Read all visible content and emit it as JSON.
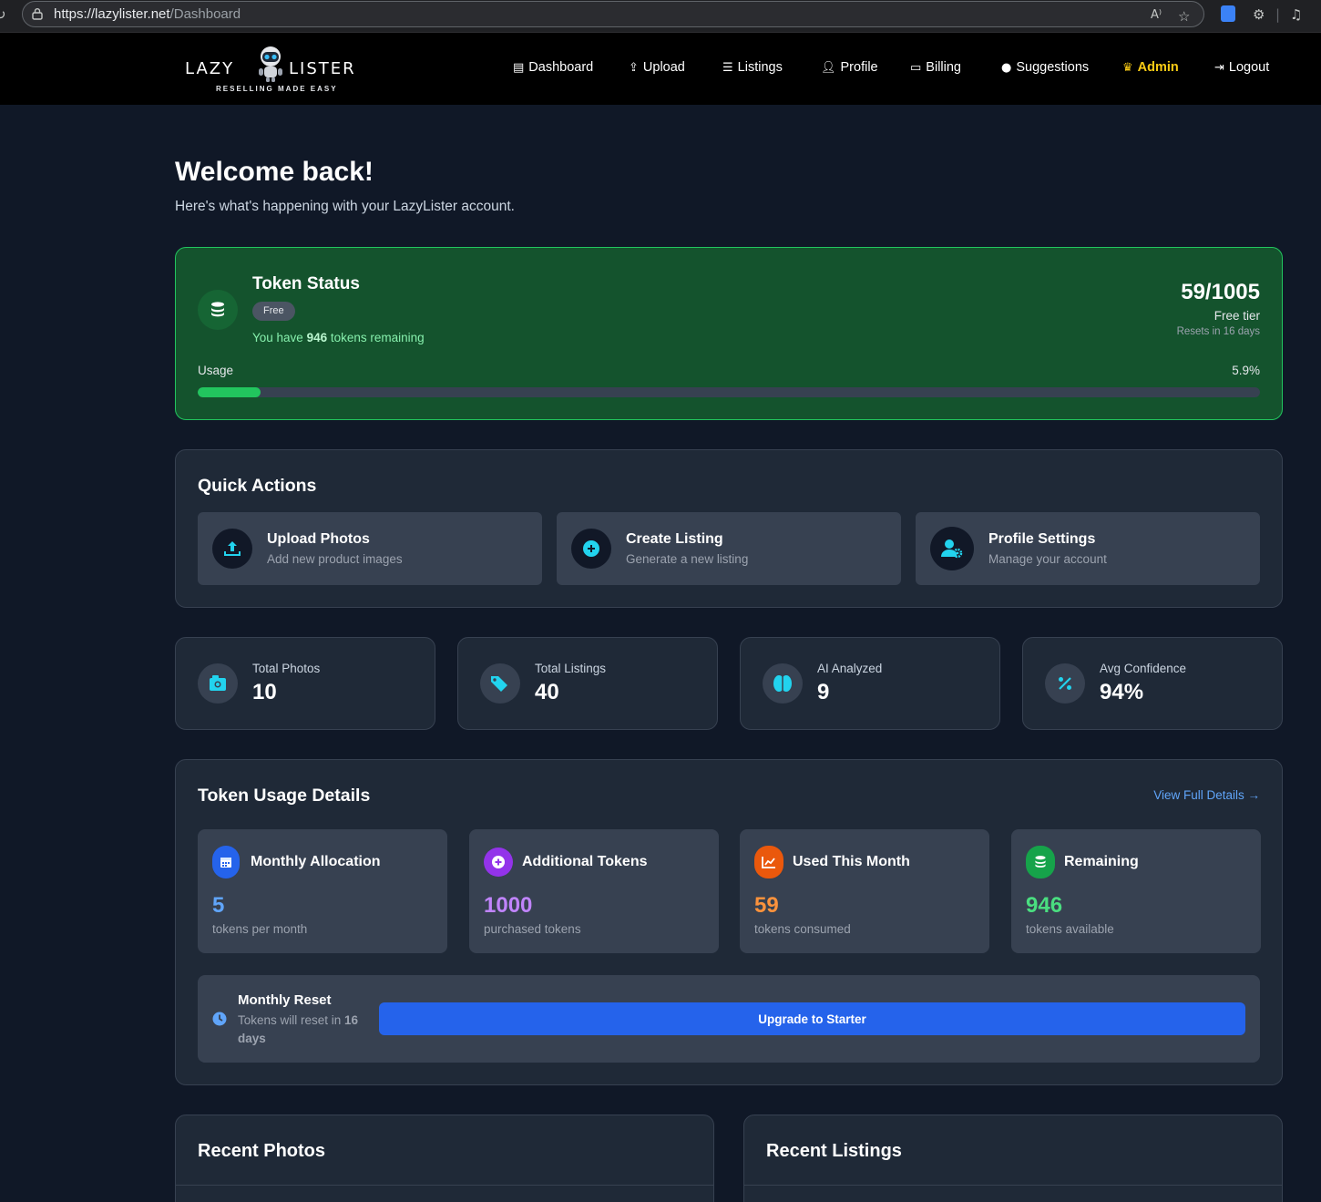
{
  "browser": {
    "url_host": "https://lazylister.net",
    "url_path": "/Dashboard",
    "icons": [
      "refresh-icon",
      "lock-icon",
      "read-aloud-icon",
      "favorite-star-icon",
      "bitwarden-icon",
      "extensions-icon",
      "media-icon"
    ]
  },
  "brand": {
    "word_left": "LAZY",
    "word_right": "LISTER",
    "tagline": "RESELLING MADE EASY"
  },
  "nav": {
    "dashboard": "Dashboard",
    "upload": "Upload",
    "listings": "Listings",
    "profile": "Profile",
    "billing": "Billing",
    "suggestions": "Suggestions",
    "admin": "Admin",
    "logout": "Logout"
  },
  "welcome": {
    "title": "Welcome back!",
    "subtitle": "Here's what's happening with your LazyLister account."
  },
  "token_status": {
    "title": "Token Status",
    "plan_badge": "Free",
    "remaining_prefix": "You have ",
    "remaining_count": "946",
    "remaining_suffix": " tokens remaining",
    "ratio": "59/1005",
    "tier": "Free tier",
    "reset": "Resets in 16 days",
    "usage_label": "Usage",
    "usage_percent_text": "5.9%",
    "usage_fraction": 0.059
  },
  "quick_actions": {
    "title": "Quick Actions",
    "items": [
      {
        "title": "Upload Photos",
        "subtitle": "Add new product images"
      },
      {
        "title": "Create Listing",
        "subtitle": "Generate a new listing"
      },
      {
        "title": "Profile Settings",
        "subtitle": "Manage your account"
      }
    ]
  },
  "stats": [
    {
      "label": "Total Photos",
      "value": "10"
    },
    {
      "label": "Total Listings",
      "value": "40"
    },
    {
      "label": "AI Analyzed",
      "value": "9"
    },
    {
      "label": "Avg Confidence",
      "value": "94%"
    }
  ],
  "token_details": {
    "title": "Token Usage Details",
    "view_link": "View Full Details →",
    "tiles": [
      {
        "title": "Monthly Allocation",
        "value": "5",
        "subtitle": "tokens per month",
        "color": "#60a5fa",
        "icon_bg": "#2563eb"
      },
      {
        "title": "Additional Tokens",
        "value": "1000",
        "subtitle": "purchased tokens",
        "color": "#c084fc",
        "icon_bg": "#9333ea"
      },
      {
        "title": "Used This Month",
        "value": "59",
        "subtitle": "tokens consumed",
        "color": "#fb923c",
        "icon_bg": "#ea580c"
      },
      {
        "title": "Remaining",
        "value": "946",
        "subtitle": "tokens available",
        "color": "#4ade80",
        "icon_bg": "#16a34a"
      }
    ],
    "reset_title": "Monthly Reset",
    "reset_prefix": "Tokens will reset in ",
    "reset_days": "16",
    "reset_suffix": " days",
    "upgrade_label": "Upgrade to Starter"
  },
  "recent": {
    "photos_title": "Recent Photos",
    "listings_title": "Recent Listings"
  },
  "colors": {
    "accent": "#2563eb",
    "token_bg": "#14532d",
    "token_border": "#22c55e",
    "icon_cyan": "#22d3ee",
    "admin": "#facc15"
  }
}
